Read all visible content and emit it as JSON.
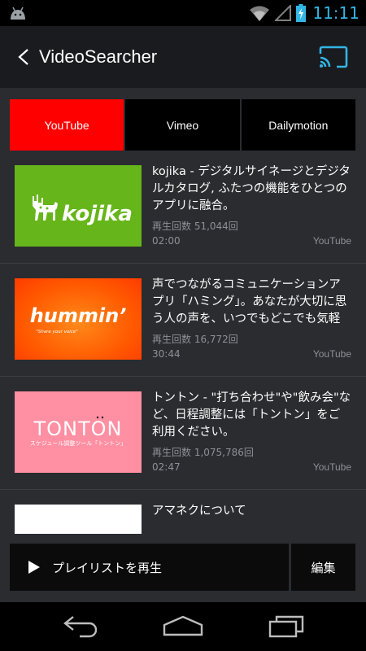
{
  "status": {
    "time": "11:11"
  },
  "app": {
    "title": "VideoSearcher"
  },
  "tabs": [
    {
      "label": "YouTube",
      "active": true
    },
    {
      "label": "Vimeo",
      "active": false
    },
    {
      "label": "Dailymotion",
      "active": false
    }
  ],
  "videos": [
    {
      "title": "kojika - デジタルサイネージとデジタルカタログ, ふたつの機能をひとつのアプリに融合。",
      "views": "再生回数 51,044回",
      "duration": "02:00",
      "source": "YouTube",
      "logo": "kojika"
    },
    {
      "title": "声でつながるコミュニケーションアプリ「ハミング」。あなたが大切に思う人の声を、いつでもどこでも気軽に聴…",
      "views": "再生回数 16,772回",
      "duration": "30:44",
      "source": "YouTube",
      "logo": "hummin’",
      "logo_sub": "\"Share your voice\""
    },
    {
      "title": "トントン - \"打ち合わせ\"や\"飲み会\"など、日程調整には「トントン」をご利用ください。",
      "views": "再生回数 1,075,786回",
      "duration": "02:47",
      "source": "YouTube",
      "logo": "TONTON",
      "logo_sub": "スケジュール調整ツール「トントン」"
    },
    {
      "title": "アマネクについて",
      "views": "",
      "duration": "",
      "source": ""
    }
  ],
  "bottom": {
    "play_label": "プレイリストを再生",
    "edit_label": "編集"
  },
  "colors": {
    "accent": "#33b5e5",
    "youtube": "#ff0000",
    "kojika": "#66b51a",
    "hummin": "#ff5a00",
    "tonton": "#ff8fa2"
  },
  "icons": [
    "android-icon",
    "wifi-icon",
    "signal-icon",
    "battery-icon",
    "back-chevron-icon",
    "cast-icon",
    "play-icon",
    "nav-back-icon",
    "nav-home-icon",
    "nav-recents-icon"
  ]
}
